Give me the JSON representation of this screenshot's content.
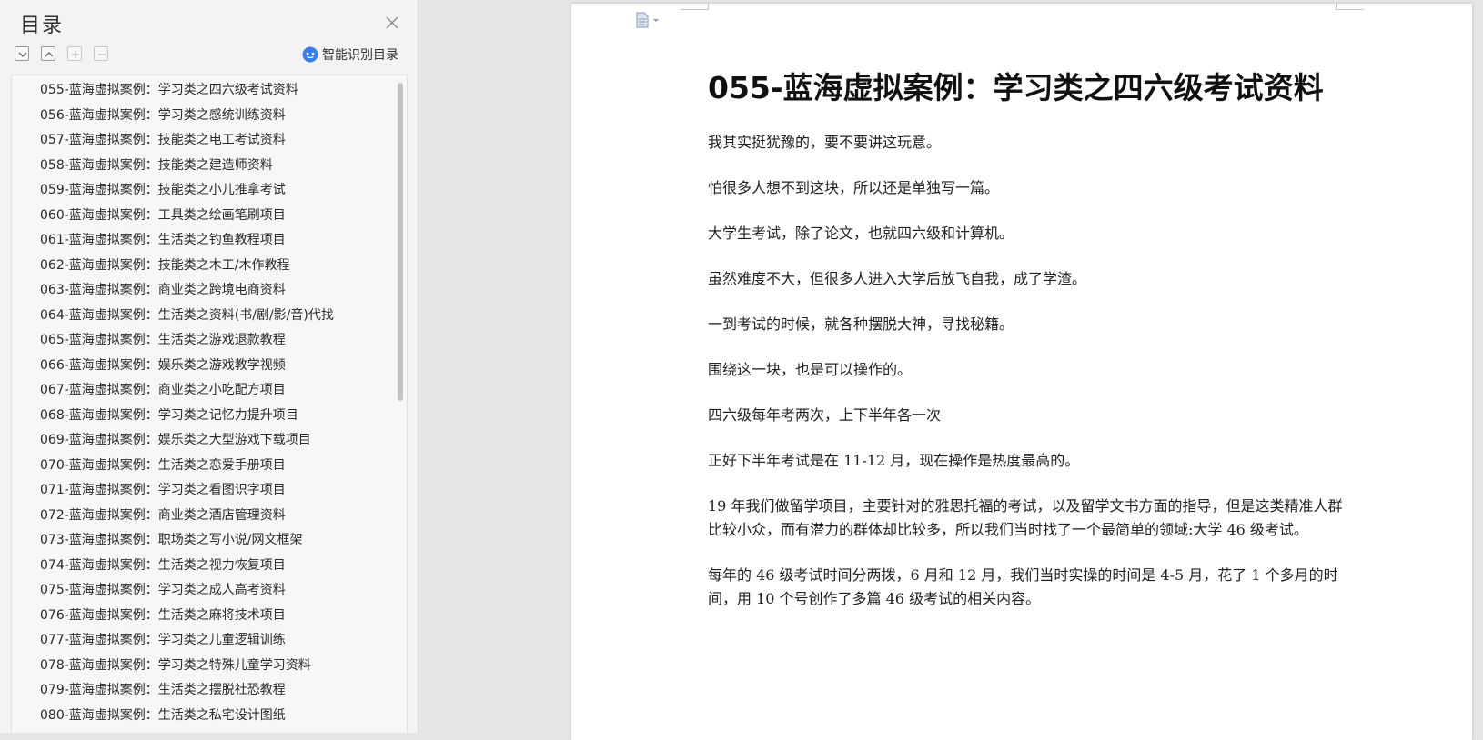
{
  "toc": {
    "title": "目录",
    "smart_toc_label": "智能识别目录",
    "items": [
      "055-蓝海虚拟案例：学习类之四六级考试资料",
      "056-蓝海虚拟案例：学习类之感统训练资料",
      "057-蓝海虚拟案例：技能类之电工考试资料",
      "058-蓝海虚拟案例：技能类之建造师资料",
      "059-蓝海虚拟案例：技能类之小儿推拿考试",
      "060-蓝海虚拟案例：工具类之绘画笔刷项目",
      "061-蓝海虚拟案例：生活类之钓鱼教程项目",
      "062-蓝海虚拟案例：技能类之木工/木作教程",
      "063-蓝海虚拟案例：商业类之跨境电商资料",
      "064-蓝海虚拟案例：生活类之资料(书/剧/影/音)代找",
      "065-蓝海虚拟案例：生活类之游戏退款教程",
      "066-蓝海虚拟案例：娱乐类之游戏教学视频",
      "067-蓝海虚拟案例：商业类之小吃配方项目",
      "068-蓝海虚拟案例：学习类之记忆力提升项目",
      "069-蓝海虚拟案例：娱乐类之大型游戏下载项目",
      "070-蓝海虚拟案例：生活类之恋爱手册项目",
      "071-蓝海虚拟案例：学习类之看图识字项目",
      "072-蓝海虚拟案例：商业类之酒店管理资料",
      "073-蓝海虚拟案例：职场类之写小说/网文框架",
      "074-蓝海虚拟案例：生活类之视力恢复项目",
      "075-蓝海虚拟案例：学习类之成人高考资料",
      "076-蓝海虚拟案例：生活类之麻将技术项目",
      "077-蓝海虚拟案例：学习类之儿童逻辑训练",
      "078-蓝海虚拟案例：学习类之特殊儿童学习资料",
      "079-蓝海虚拟案例：生活类之摆脱社恐教程",
      "080-蓝海虚拟案例：生活类之私宅设计图纸"
    ]
  },
  "document": {
    "title": "055-蓝海虚拟案例：学习类之四六级考试资料",
    "paragraphs": [
      "我其实挺犹豫的，要不要讲这玩意。",
      "怕很多人想不到这块，所以还是单独写一篇。",
      "大学生考试，除了论文，也就四六级和计算机。",
      "虽然难度不大，但很多人进入大学后放飞自我，成了学渣。",
      "一到考试的时候，就各种摆脱大神，寻找秘籍。",
      "围绕这一块，也是可以操作的。",
      "四六级每年考两次，上下半年各一次",
      "正好下半年考试是在 11-12 月，现在操作是热度最高的。",
      "19 年我们做留学项目，主要针对的雅思托福的考试，以及留学文书方面的指导，但是这类精准人群比较小众，而有潜力的群体却比较多，所以我们当时找了一个最简单的领域:大学 46 级考试。",
      "每年的 46 级考试时间分两拨，6 月和 12 月，我们当时实操的时间是 4-5 月，花了 1 个多月的时间，用 10 个号创作了多篇 46 级考试的相关内容。"
    ]
  },
  "icons": {
    "toc_close": "close-icon",
    "expand_all": "chevron-down-icon",
    "collapse_all": "chevron-up-icon",
    "add_level": "plus-icon",
    "remove_level": "minus-icon",
    "smart_toc": "smart-recognize-icon",
    "doc_nav": "document-icon"
  },
  "colors": {
    "panel_bg": "#f3f3f3",
    "workspace_bg": "#e6e6e6",
    "smart_icon": "#3a7ee8"
  }
}
